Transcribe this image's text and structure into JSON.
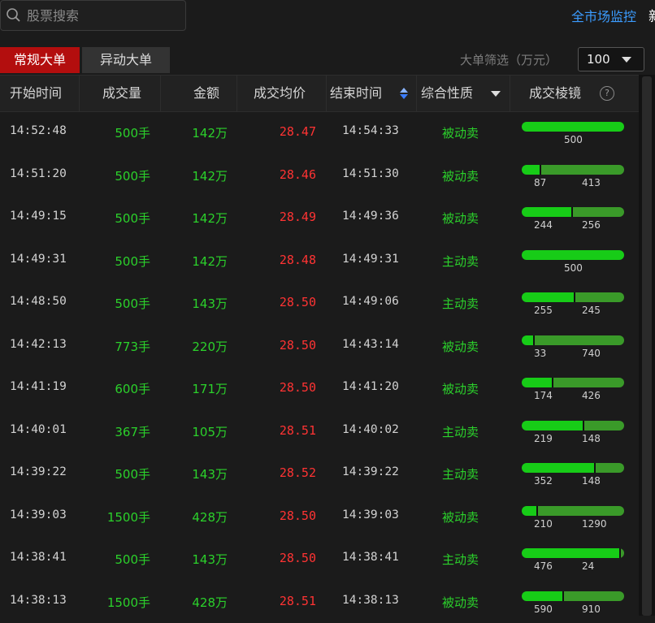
{
  "search": {
    "placeholder": "股票搜索"
  },
  "top_link": "全市场监控",
  "top_cut_text": "新",
  "tabs": [
    {
      "label": "常规大单",
      "active": true
    },
    {
      "label": "异动大单",
      "active": false
    }
  ],
  "filter": {
    "label": "大单筛选（万元）",
    "value": "100"
  },
  "columns": [
    {
      "label": "开始时间"
    },
    {
      "label": "成交量"
    },
    {
      "label": "金额"
    },
    {
      "label": "成交均价"
    },
    {
      "label": "结束时间"
    },
    {
      "label": "综合性质"
    },
    {
      "label": "成交棱镜"
    }
  ],
  "colors": {
    "accent_red": "#b30e0e",
    "price_red": "#ff3333",
    "green": "#2bd12b",
    "link_blue": "#3b9cff"
  },
  "rows": [
    {
      "start": "14:52:48",
      "volume": "500手",
      "amount": "142万",
      "price": "28.47",
      "end": "14:54:33",
      "nature": "被动卖",
      "prism": [
        500
      ]
    },
    {
      "start": "14:51:20",
      "volume": "500手",
      "amount": "142万",
      "price": "28.46",
      "end": "14:51:30",
      "nature": "被动卖",
      "prism": [
        87,
        413
      ]
    },
    {
      "start": "14:49:15",
      "volume": "500手",
      "amount": "142万",
      "price": "28.49",
      "end": "14:49:36",
      "nature": "被动卖",
      "prism": [
        244,
        256
      ]
    },
    {
      "start": "14:49:31",
      "volume": "500手",
      "amount": "142万",
      "price": "28.48",
      "end": "14:49:31",
      "nature": "主动卖",
      "prism": [
        500
      ]
    },
    {
      "start": "14:48:50",
      "volume": "500手",
      "amount": "143万",
      "price": "28.50",
      "end": "14:49:06",
      "nature": "主动卖",
      "prism": [
        255,
        245
      ]
    },
    {
      "start": "14:42:13",
      "volume": "773手",
      "amount": "220万",
      "price": "28.50",
      "end": "14:43:14",
      "nature": "被动卖",
      "prism": [
        33,
        740
      ]
    },
    {
      "start": "14:41:19",
      "volume": "600手",
      "amount": "171万",
      "price": "28.50",
      "end": "14:41:20",
      "nature": "被动卖",
      "prism": [
        174,
        426
      ]
    },
    {
      "start": "14:40:01",
      "volume": "367手",
      "amount": "105万",
      "price": "28.51",
      "end": "14:40:02",
      "nature": "主动卖",
      "prism": [
        219,
        148
      ]
    },
    {
      "start": "14:39:22",
      "volume": "500手",
      "amount": "143万",
      "price": "28.52",
      "end": "14:39:22",
      "nature": "主动卖",
      "prism": [
        352,
        148
      ]
    },
    {
      "start": "14:39:03",
      "volume": "1500手",
      "amount": "428万",
      "price": "28.50",
      "end": "14:39:03",
      "nature": "被动卖",
      "prism": [
        210,
        1290
      ]
    },
    {
      "start": "14:38:41",
      "volume": "500手",
      "amount": "143万",
      "price": "28.50",
      "end": "14:38:41",
      "nature": "主动卖",
      "prism": [
        476,
        24
      ]
    },
    {
      "start": "14:38:13",
      "volume": "1500手",
      "amount": "428万",
      "price": "28.51",
      "end": "14:38:13",
      "nature": "被动卖",
      "prism": [
        590,
        910
      ]
    }
  ]
}
